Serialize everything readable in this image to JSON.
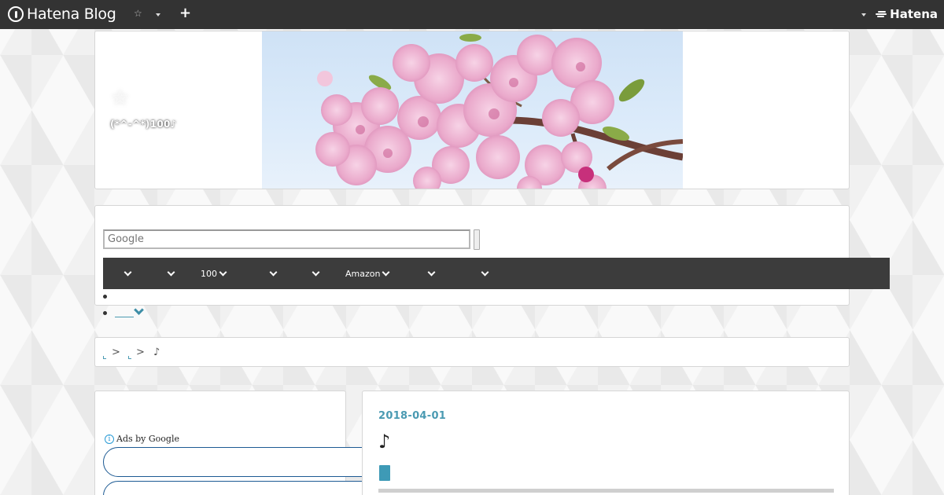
{
  "globalbar": {
    "logo_text": "Hatena Blog",
    "star_glyph": "☆",
    "plus_glyph": "+",
    "brand_text": "Hatena"
  },
  "header": {
    "star_glyph": "☆",
    "blog_title": "(*^-^*)100♪",
    "image_subject": "pink cherry blossoms against blue sky"
  },
  "search": {
    "placeholder": "Google"
  },
  "nav": {
    "items": [
      {
        "label": ""
      },
      {
        "label": ""
      },
      {
        "label": "100"
      },
      {
        "label": ""
      },
      {
        "label": ""
      },
      {
        "label": "Amazon"
      },
      {
        "label": ""
      },
      {
        "label": ""
      }
    ]
  },
  "breadcrumb": {
    "separator": ">",
    "current": "♪"
  },
  "sidebar": {
    "ads_info_glyph": "i",
    "ads_label": "Ads by Google"
  },
  "article": {
    "date": "2018-04-01",
    "title": "♪"
  },
  "colors": {
    "accent": "#4a9ab2",
    "globalbar": "#333333",
    "navbar": "#3c3c3c",
    "ad_border": "#1d5a93"
  }
}
